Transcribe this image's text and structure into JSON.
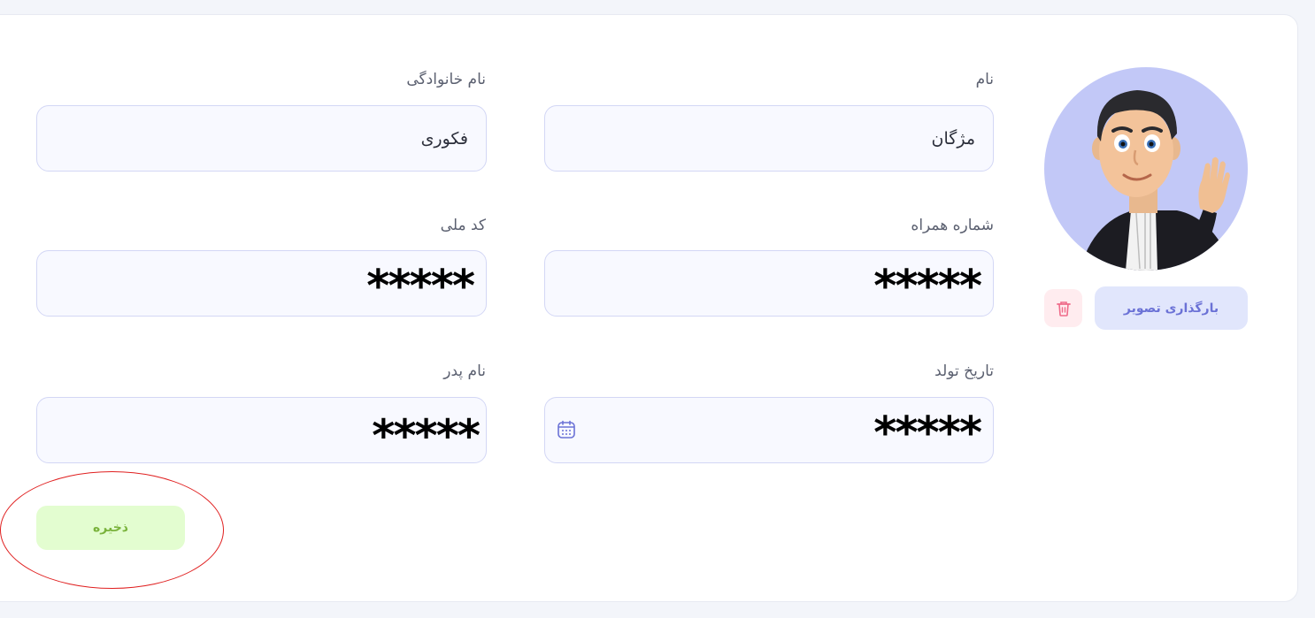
{
  "profile": {
    "upload_label": "بارگذاری تصویر",
    "avatar_icon": "avatar-lawyer-waving",
    "delete_icon": "trash-icon"
  },
  "form": {
    "first_name": {
      "label": "نام",
      "value": "مژگان"
    },
    "last_name": {
      "label": "نام خانوادگی",
      "value": "فکوری"
    },
    "mobile": {
      "label": "شماره همراه",
      "masked": "*****"
    },
    "national_code": {
      "label": "کد ملی",
      "masked": "*****"
    },
    "birth_date": {
      "label": "تاریخ تولد",
      "masked": "*****",
      "icon": "calendar-icon"
    },
    "father_name": {
      "label": "نام پدر",
      "masked": "*****"
    },
    "save_label": "ذخیره"
  },
  "colors": {
    "accent": "#6b72d6",
    "save_text": "#7ab33c",
    "save_bg": "#e3fdd0",
    "annotation": "#e02020"
  }
}
